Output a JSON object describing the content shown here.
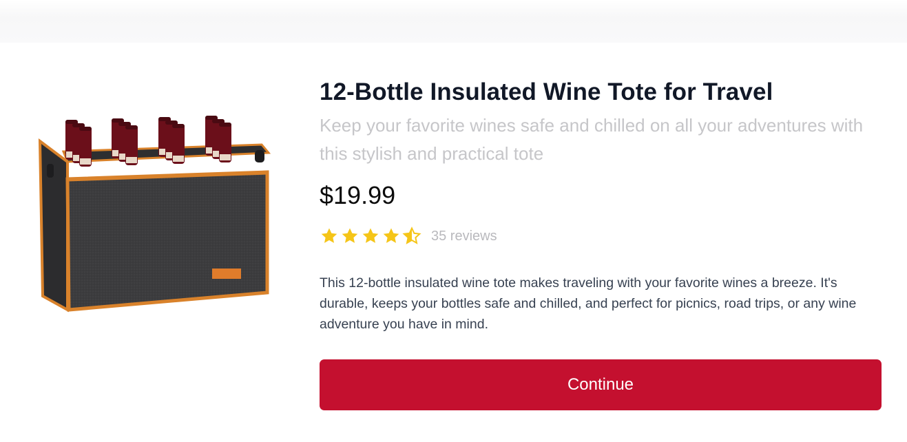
{
  "product": {
    "title": "12-Bottle Insulated Wine Tote for Travel",
    "subtitle": "Keep your favorite wines safe and chilled on all your adventures with this stylish and practical tote",
    "price": "$19.99",
    "rating": 4.5,
    "rating_max": 5,
    "reviews": "35 reviews",
    "description": "This 12-bottle insulated wine tote makes traveling with your favorite wines a breeze. It's durable, keeps your bottles safe and chilled, and perfect for picnics, road trips, or any wine adventure you have in mind.",
    "image_icon": "wine-tote-image"
  },
  "actions": {
    "continue_label": "Continue"
  },
  "colors": {
    "accent": "#c4102f",
    "star": "#f5c518",
    "tote_felt": "#3a3a3c",
    "tote_trim": "#d9822b",
    "bottle": "#6b0f1a"
  }
}
